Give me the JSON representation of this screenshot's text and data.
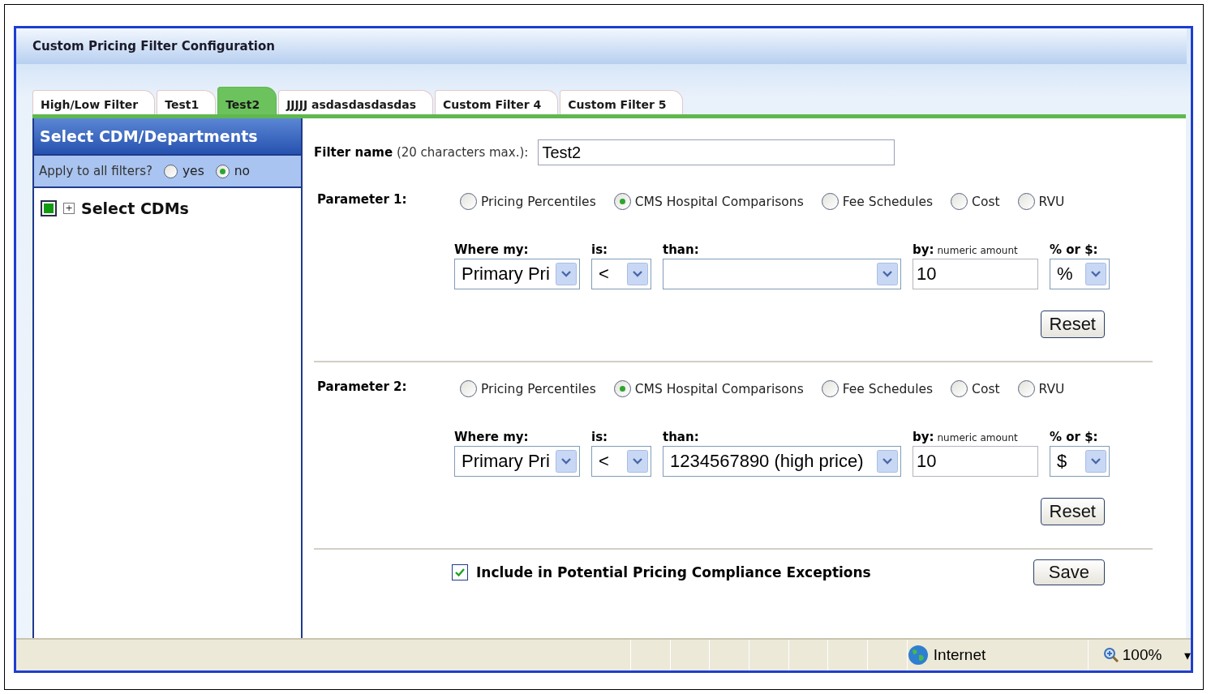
{
  "window": {
    "title": "Custom Pricing Filter Configuration"
  },
  "tabs": [
    {
      "label": "High/Low Filter",
      "selected": false
    },
    {
      "label": "Test1",
      "selected": false
    },
    {
      "label": "Test2",
      "selected": true
    },
    {
      "label": "JJJJJ asdasdasdasdas",
      "selected": false
    },
    {
      "label": "Custom Filter 4",
      "selected": false
    },
    {
      "label": "Custom Filter 5",
      "selected": false
    }
  ],
  "sidebar": {
    "title": "Select CDM/Departments",
    "apply_label": "Apply to all filters?",
    "apply_options": [
      {
        "label": "yes",
        "selected": false
      },
      {
        "label": "no",
        "selected": true
      }
    ],
    "tree": [
      {
        "label": "Select CDMs",
        "checked": true,
        "expander": "+"
      }
    ]
  },
  "filter_name": {
    "label": "Filter name",
    "hint": "(20 characters max.):",
    "value": "Test2"
  },
  "parameters": [
    {
      "label": "Parameter 1:",
      "options": [
        {
          "label": "Pricing Percentiles",
          "selected": false
        },
        {
          "label": "CMS Hospital Comparisons",
          "selected": true
        },
        {
          "label": "Fee Schedules",
          "selected": false
        },
        {
          "label": "Cost",
          "selected": false
        },
        {
          "label": "RVU",
          "selected": false
        }
      ],
      "fields": [
        {
          "kind": "select",
          "label": "Where my:",
          "value": "Primary Pri"
        },
        {
          "kind": "select",
          "label": "is:",
          "value": "<"
        },
        {
          "kind": "select",
          "label": "than:"
        },
        {
          "kind": "input",
          "label": "by:",
          "note": "numeric amount",
          "value": "10"
        },
        {
          "kind": "select",
          "label": "% or $:",
          "value": "%"
        }
      ],
      "reset": "Reset"
    },
    {
      "label": "Parameter 2:",
      "options": [
        {
          "label": "Pricing Percentiles",
          "selected": false
        },
        {
          "label": "CMS Hospital Comparisons",
          "selected": true
        },
        {
          "label": "Fee Schedules",
          "selected": false
        },
        {
          "label": "Cost",
          "selected": false
        },
        {
          "label": "RVU",
          "selected": false
        }
      ],
      "fields": [
        {
          "kind": "select",
          "label": "Where my:",
          "value": "Primary Pri"
        },
        {
          "kind": "select",
          "label": "is:",
          "value": "<"
        },
        {
          "kind": "select",
          "label": "than:",
          "value": "1234567890 (high price)"
        },
        {
          "kind": "input",
          "label": "by:",
          "note": "numeric amount",
          "value": "10"
        },
        {
          "kind": "select",
          "label": "% or $:",
          "value": "$"
        }
      ],
      "reset": "Reset"
    }
  ],
  "exceptions": {
    "label": "Include in Potential Pricing Compliance Exceptions",
    "checked": true
  },
  "save": "Save",
  "status_bar": {
    "zone": "Internet",
    "zoom": "100%",
    "menu": "▾"
  }
}
